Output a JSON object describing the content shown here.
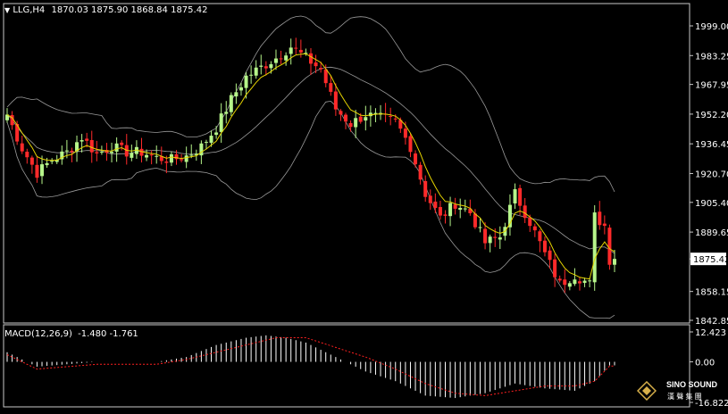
{
  "chart_header": {
    "triangle": "▼",
    "symbol": "LLG,H4",
    "ohlc": "1870.03 1875.90 1868.84 1875.42"
  },
  "macd_header": {
    "name": "MACD(12,26,9)",
    "values": "-1.480 -1.761"
  },
  "current_price_label": "1875.42",
  "logo": {
    "text": "SINO SOUND",
    "subtext": "漢 聲 集 團",
    "icon": "diamond-logo-icon"
  },
  "colors": {
    "background": "#000000",
    "bull": "#b6f58a",
    "bear": "#ff2a2a",
    "ma": "#e6d400",
    "bands": "#9a9a9a",
    "macd_hist": "#ffffff",
    "macd_signal": "#ff2020"
  },
  "chart_data": [
    {
      "type": "candlestick",
      "title": "LLG,H4",
      "ylim": [
        1838,
        2005
      ],
      "y_ticks": [
        "1999.00",
        "1983.25",
        "1967.95",
        "1952.20",
        "1936.45",
        "1920.70",
        "1905.40",
        "1889.65",
        "1875.42",
        "1858.15",
        "1842.85"
      ],
      "ma_color": "yellow",
      "bands_color": "gray",
      "grid": false,
      "close_path": [
        [
          0,
          1952
        ],
        [
          3,
          1934
        ],
        [
          6,
          1921
        ],
        [
          9,
          1928
        ],
        [
          12,
          1932
        ],
        [
          15,
          1940
        ],
        [
          18,
          1931
        ],
        [
          21,
          1935
        ],
        [
          24,
          1932
        ],
        [
          27,
          1932
        ],
        [
          30,
          1929
        ],
        [
          33,
          1928
        ],
        [
          36,
          1930
        ],
        [
          39,
          1935
        ],
        [
          42,
          1945
        ],
        [
          45,
          1960
        ],
        [
          48,
          1972
        ],
        [
          51,
          1977
        ],
        [
          54,
          1982
        ],
        [
          57,
          1988
        ],
        [
          60,
          1982
        ],
        [
          63,
          1976
        ],
        [
          66,
          1955
        ],
        [
          69,
          1947
        ],
        [
          72,
          1952
        ],
        [
          75,
          1950
        ],
        [
          78,
          1948
        ],
        [
          81,
          1935
        ],
        [
          84,
          1910
        ],
        [
          87,
          1897
        ],
        [
          90,
          1905
        ],
        [
          93,
          1900
        ],
        [
          96,
          1884
        ],
        [
          99,
          1887
        ],
        [
          102,
          1910
        ],
        [
          105,
          1895
        ],
        [
          108,
          1878
        ],
        [
          111,
          1862
        ],
        [
          114,
          1867
        ],
        [
          117,
          1862
        ],
        [
          118,
          1898
        ],
        [
          120,
          1893
        ],
        [
          121,
          1875
        ]
      ]
    },
    {
      "type": "bar",
      "title": "MACD(12,26,9)",
      "ylim": [
        -16.822,
        12.423
      ],
      "y_ticks": [
        "12.423",
        "0.00",
        "-16.822"
      ],
      "macd_path": [
        [
          0,
          4
        ],
        [
          6,
          -2
        ],
        [
          12,
          -1
        ],
        [
          18,
          0
        ],
        [
          24,
          0
        ],
        [
          30,
          0
        ],
        [
          36,
          2
        ],
        [
          42,
          7
        ],
        [
          48,
          10
        ],
        [
          52,
          11
        ],
        [
          56,
          10
        ],
        [
          60,
          8
        ],
        [
          66,
          2
        ],
        [
          72,
          -4
        ],
        [
          78,
          -8
        ],
        [
          84,
          -14
        ],
        [
          90,
          -15
        ],
        [
          96,
          -13
        ],
        [
          102,
          -9
        ],
        [
          108,
          -11
        ],
        [
          114,
          -12
        ],
        [
          118,
          -8
        ],
        [
          121,
          -1.48
        ]
      ],
      "signal_path": [
        [
          0,
          3
        ],
        [
          6,
          -3
        ],
        [
          12,
          -2
        ],
        [
          18,
          -1
        ],
        [
          24,
          -1
        ],
        [
          30,
          -1
        ],
        [
          36,
          1
        ],
        [
          42,
          4
        ],
        [
          48,
          7
        ],
        [
          54,
          10
        ],
        [
          60,
          10
        ],
        [
          66,
          6
        ],
        [
          72,
          2
        ],
        [
          78,
          -3
        ],
        [
          84,
          -9
        ],
        [
          90,
          -13
        ],
        [
          96,
          -14
        ],
        [
          102,
          -12
        ],
        [
          108,
          -10
        ],
        [
          114,
          -10
        ],
        [
          118,
          -8
        ],
        [
          121,
          -1.761
        ]
      ]
    }
  ]
}
